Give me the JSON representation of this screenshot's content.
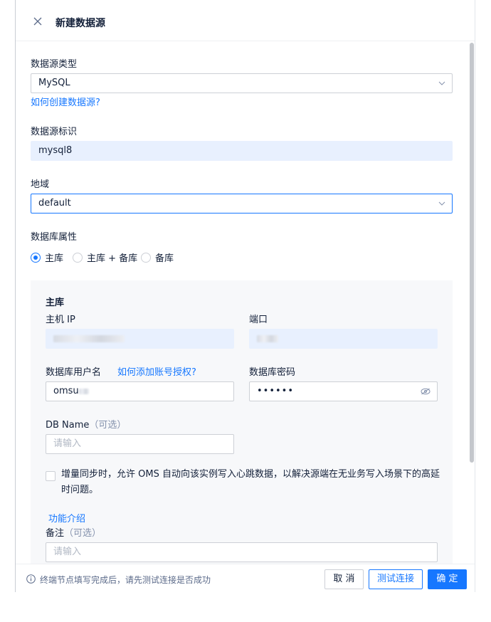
{
  "header": {
    "title": "新建数据源"
  },
  "form": {
    "source_type": {
      "label": "数据源类型",
      "value": "MySQL",
      "help_link": "如何创建数据源?"
    },
    "source_id": {
      "label": "数据源标识",
      "value": "mysql8"
    },
    "region": {
      "label": "地域",
      "value": "default"
    },
    "db_attr": {
      "label": "数据库属性",
      "options": [
        "主库",
        "主库 + 备库",
        "备库"
      ],
      "selected": "主库"
    },
    "primary": {
      "title": "主库",
      "host_label": "主机 IP",
      "port_label": "端口",
      "user_label": "数据库用户名",
      "user_help_link": "如何添加账号授权?",
      "user_value": "omsu",
      "password_label": "数据库密码",
      "password_value": "••••••",
      "dbname_label": "DB Name",
      "dbname_optional": "（可选）",
      "dbname_placeholder": "请输入",
      "heartbeat_text": "增量同步时，允许 OMS 自动向该实例写入心跳数据，以解决源端在无业务写入场景下的高延时问题。",
      "feature_link": "功能介绍"
    },
    "remark": {
      "label": "备注",
      "optional": "（可选）",
      "placeholder": "请输入"
    }
  },
  "footer": {
    "tip": "终端节点填写完成后，请先测试连接是否成功",
    "cancel_label": "取 消",
    "test_label": "测试连接",
    "ok_label": "确 定"
  },
  "colors": {
    "accent": "#1677ff",
    "filled_input": "#e8f0fe",
    "sub_bg": "#f7f8fa"
  },
  "icons": [
    "close-icon",
    "chevron-down-icon",
    "eye-off-icon",
    "info-icon"
  ]
}
